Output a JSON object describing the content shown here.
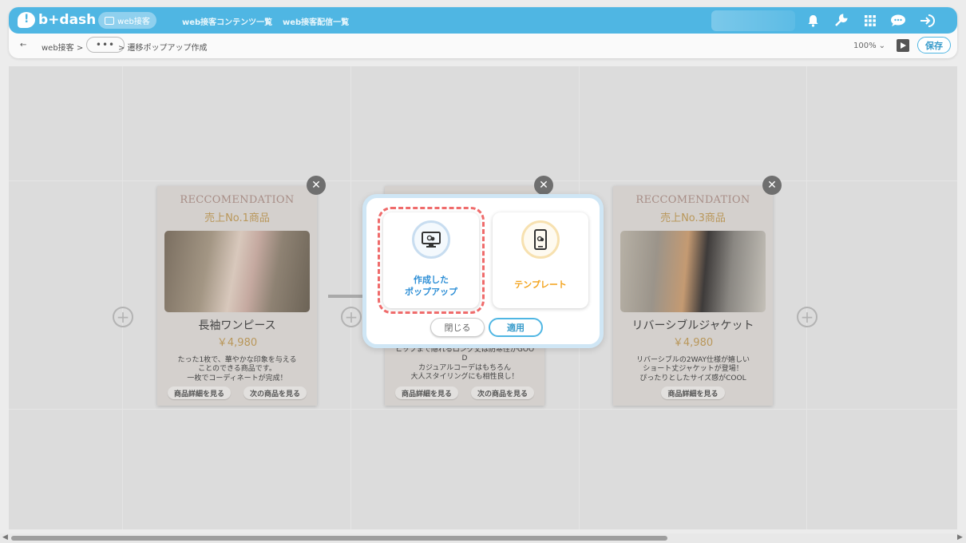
{
  "header": {
    "logo": "b+dash",
    "nav_active": "web接客",
    "nav_links": [
      "web接客コンテンツ一覧",
      "web接客配信一覧"
    ]
  },
  "breadcrumb": {
    "back": "←",
    "root": "web接客 >",
    "ellipsis": "•••",
    "current": "> 遷移ポップアップ作成"
  },
  "toolbar": {
    "zoom": "100%",
    "zoom_caret": "⌄",
    "save": "保存"
  },
  "cards": [
    {
      "subtitle": "RECCOMENDATION",
      "rank": "売上No.1商品",
      "name": "長袖ワンピース",
      "price": "￥4,980",
      "desc": [
        "たった1枚で、華やかな印象を与える",
        "ことのできる商品です。",
        "一枚でコーディネートが完成！"
      ],
      "buttons": [
        "商品詳細を見る",
        "次の商品を見る"
      ]
    },
    {
      "desc": [
        "ヒップまで隠れるロング丈は防寒性がGOO",
        "D",
        "カジュアルコーデはもちろん",
        "大人スタイリングにも相性良し！"
      ],
      "buttons": [
        "商品詳細を見る",
        "次の商品を見る"
      ]
    },
    {
      "subtitle": "RECCOMENDATION",
      "rank": "売上No.3商品",
      "name": "リバーシブルジャケット",
      "price": "￥4,980",
      "desc": [
        "リバーシブルの2WAY仕様が嬉しい",
        "ショート丈ジャケットが登場！",
        "ぴったりとしたサイズ感がCOOL"
      ],
      "buttons": [
        "商品詳細を見る"
      ]
    }
  ],
  "modal": {
    "option1_line1": "作成した",
    "option1_line2": "ポップアップ",
    "option2": "テンプレート",
    "close": "閉じる",
    "apply": "適用"
  },
  "icons": {
    "close": "✕",
    "plus": "+"
  },
  "colors": {
    "accent": "#4fb6e3",
    "selected_dash": "#ef6b6b",
    "template_orange": "#f3a31c",
    "created_blue": "#2e8fd6"
  }
}
